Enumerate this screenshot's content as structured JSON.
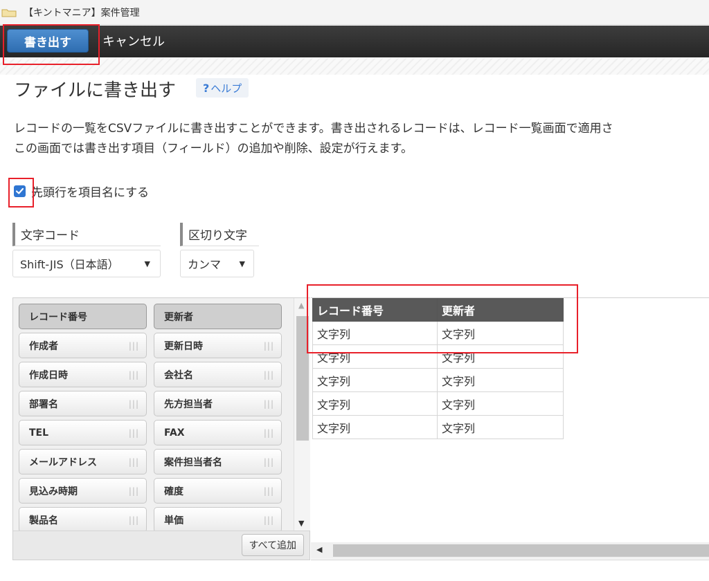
{
  "window": {
    "title": "【キントマニア】案件管理"
  },
  "toolbar": {
    "export_label": "書き出す",
    "cancel_label": "キャンセル"
  },
  "page": {
    "title": "ファイルに書き出す",
    "help": {
      "icon": "?",
      "label": "ヘルプ"
    },
    "description": [
      "レコードの一覧をCSVファイルに書き出すことができます。書き出されるレコードは、レコード一覧画面で適用さ",
      "この画面では書き出す項目（フィールド）の追加や削除、設定が行えます。"
    ]
  },
  "options": {
    "header_row": {
      "label": "先頭行を項目名にする",
      "checked": true
    },
    "encoding": {
      "label": "文字コード",
      "value": "Shift-JIS（日本語）"
    },
    "delimiter": {
      "label": "区切り文字",
      "value": "カンマ"
    }
  },
  "fields": {
    "left": [
      "レコード番号",
      "作成者",
      "作成日時",
      "部署名",
      "TEL",
      "メールアドレス",
      "見込み時期",
      "製品名"
    ],
    "right": [
      "更新者",
      "更新日時",
      "会社名",
      "先方担当者",
      "FAX",
      "案件担当者名",
      "確度",
      "単価"
    ],
    "add_all_label": "すべて追加"
  },
  "preview": {
    "headers": [
      "レコード番号",
      "更新者"
    ],
    "rows": [
      [
        "文字列",
        "文字列"
      ],
      [
        "文字列",
        "文字列"
      ],
      [
        "文字列",
        "文字列"
      ],
      [
        "文字列",
        "文字列"
      ],
      [
        "文字列",
        "文字列"
      ]
    ]
  },
  "colors": {
    "highlight": "#e8202a",
    "primary_button": "#2f6db1",
    "toolbar": "#2b2b2b",
    "table_header": "#595959"
  }
}
